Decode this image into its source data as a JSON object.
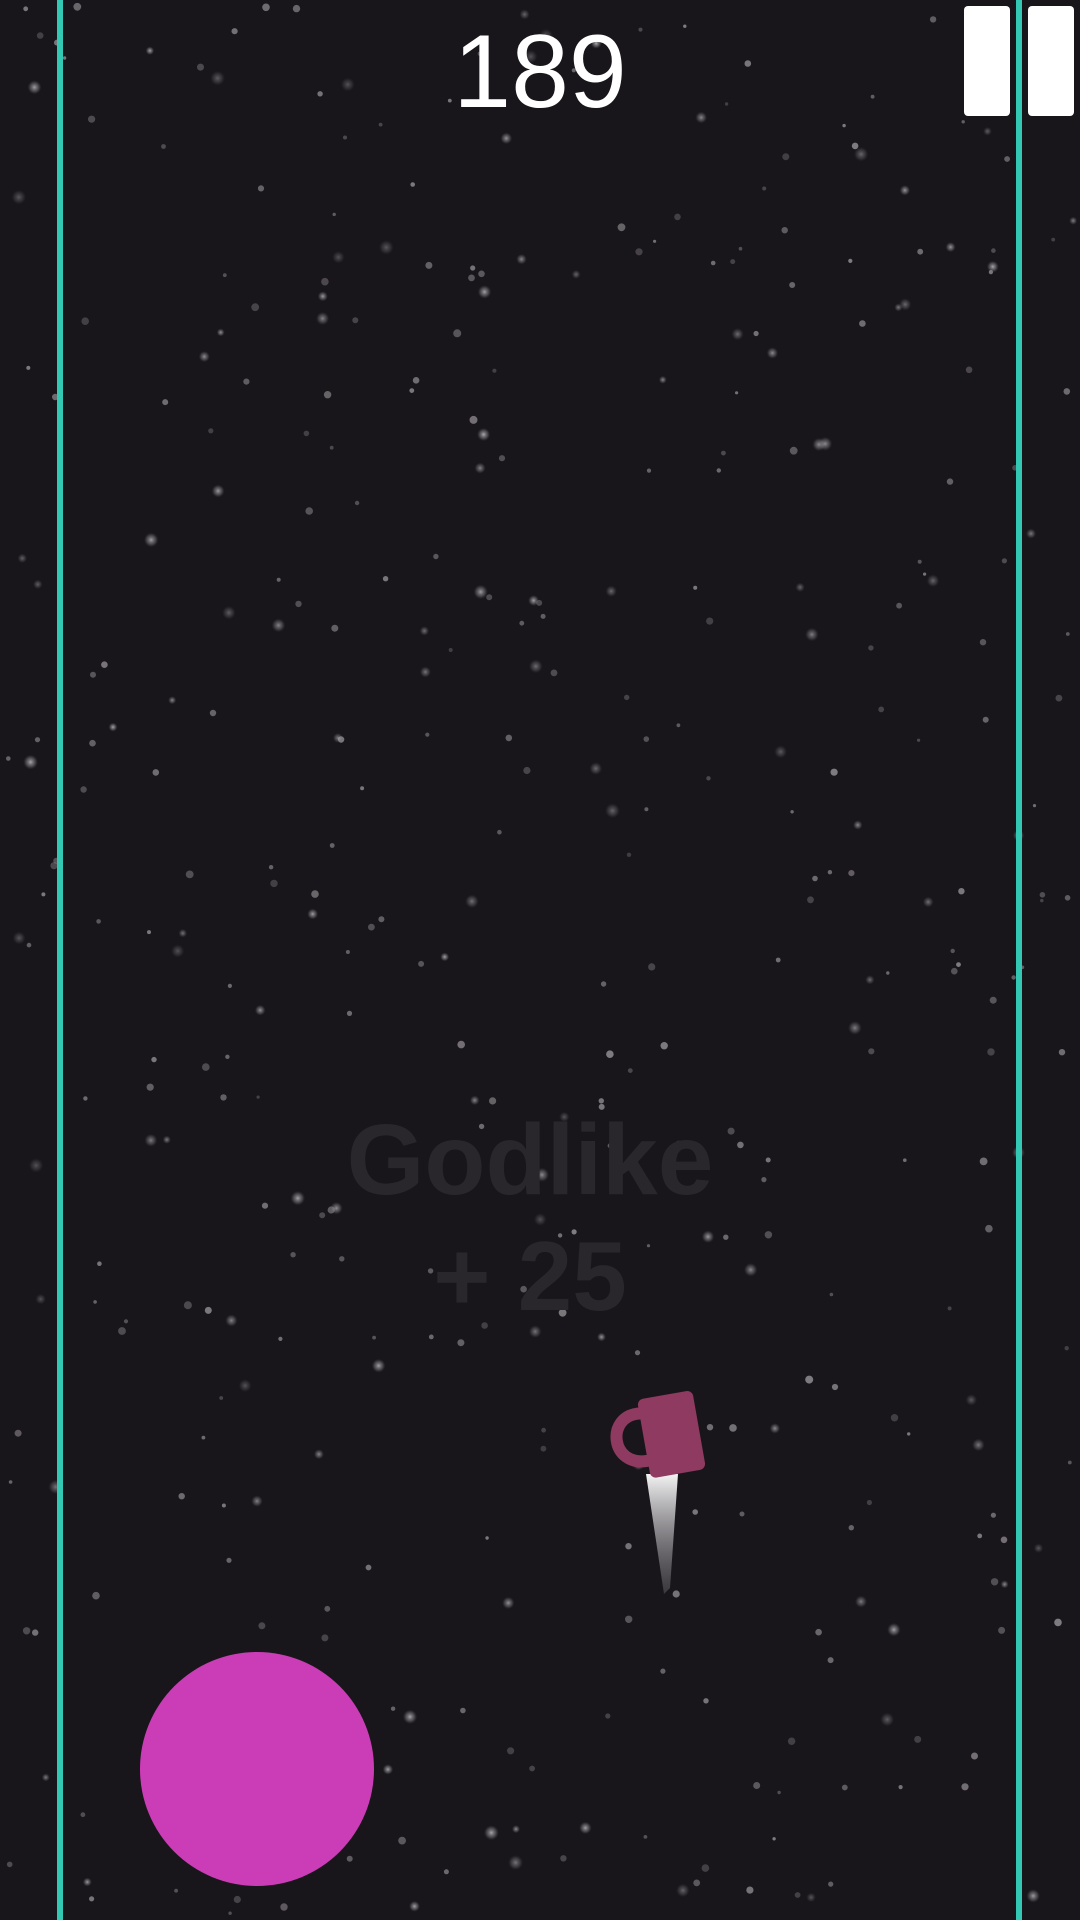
{
  "hud": {
    "score": "189",
    "pause_icon": "pause-icon"
  },
  "combo": {
    "title": "Godlike",
    "bonus": "+ 25"
  },
  "colors": {
    "background": "#19161b",
    "wall": "#33c8b4",
    "player": "#8f3a60",
    "joystick": "#cb3db7",
    "combo_text": "#2a272c",
    "stars": "#a9a6ab"
  },
  "icons": {
    "player": "padlock-ship-icon",
    "control": "joystick-circle"
  }
}
